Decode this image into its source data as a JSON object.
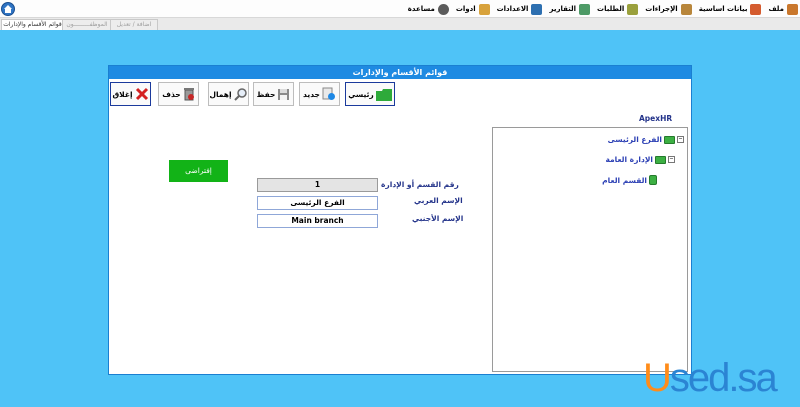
{
  "menubar": {
    "items": [
      {
        "label": "ملف",
        "icon": "file-icon",
        "color": "#c9772c"
      },
      {
        "label": "بيانات اساسية",
        "icon": "basic-data-icon",
        "color": "#d45b2e"
      },
      {
        "label": "الإجراءات",
        "icon": "procedures-icon",
        "color": "#b8863b"
      },
      {
        "label": "الطلبات",
        "icon": "requests-icon",
        "color": "#9aa03c"
      },
      {
        "label": "التقارير",
        "icon": "reports-icon",
        "color": "#4d9a66"
      },
      {
        "label": "الاعدادات",
        "icon": "settings-icon",
        "color": "#2d6fb0"
      },
      {
        "label": "ادوات",
        "icon": "tools-icon",
        "color": "#d8a23b"
      },
      {
        "label": "مساعدة",
        "icon": "help-icon",
        "color": "#5b5b5b"
      }
    ]
  },
  "tabs": [
    {
      "label": "قوائم الأقسام والإدارات",
      "active": true
    },
    {
      "label": "الموظفـــــــــون",
      "active": false
    },
    {
      "label": "اضافة / تعديل",
      "active": false
    }
  ],
  "window": {
    "title": "قوائم الأقسام والإدارات",
    "toolbar": {
      "home_label": "رئيسي",
      "new_label": "جديد",
      "save_label": "حفظ",
      "ignore_label": "إهمال",
      "delete_label": "حذف",
      "close_label": "إغلاق"
    },
    "tree": {
      "title": "ApexHR",
      "nodes": [
        {
          "label": "الفرع الرئيسى"
        },
        {
          "label": "الإدارة العامة"
        },
        {
          "label": "القسم العام"
        }
      ]
    },
    "form": {
      "dept_no_label": "رقم القسم أو الإدارة",
      "dept_no_value": "1",
      "arabic_name_label": "الإسم العربي",
      "arabic_name_value": "الفرع الرئيسى",
      "foreign_name_label": "الإسم الأجنبي",
      "foreign_name_value": "Main branch",
      "default_button": "إفتراضى"
    }
  },
  "watermark": {
    "first": "U",
    "rest": "sed.sa"
  },
  "colors": {
    "background": "#4fc3f7",
    "titlebar": "#1e8ae2",
    "default_button": "#12b317",
    "label": "#23338a"
  }
}
